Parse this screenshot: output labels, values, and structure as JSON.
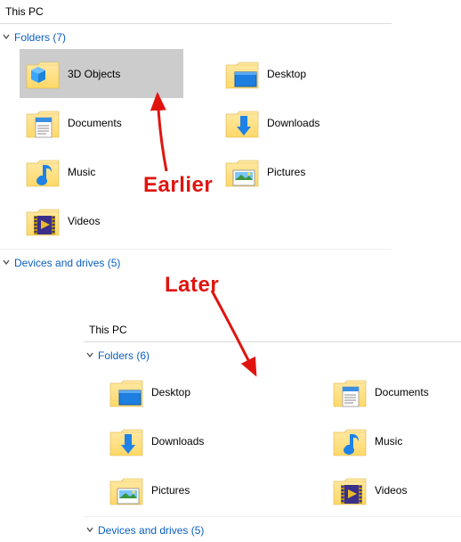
{
  "upper": {
    "breadcrumb": "This PC",
    "folders_header": "Folders (7)",
    "devices_header": "Devices and drives (5)",
    "items": [
      {
        "label": "3D Objects"
      },
      {
        "label": "Desktop"
      },
      {
        "label": "Documents"
      },
      {
        "label": "Downloads"
      },
      {
        "label": "Music"
      },
      {
        "label": "Pictures"
      },
      {
        "label": "Videos"
      }
    ]
  },
  "lower": {
    "breadcrumb": "This PC",
    "folders_header": "Folders (6)",
    "devices_header": "Devices and drives (5)",
    "items": [
      {
        "label": "Desktop"
      },
      {
        "label": "Documents"
      },
      {
        "label": "Downloads"
      },
      {
        "label": "Music"
      },
      {
        "label": "Pictures"
      },
      {
        "label": "Videos"
      }
    ]
  },
  "annotations": {
    "earlier": "Earlier",
    "later": "Later"
  }
}
